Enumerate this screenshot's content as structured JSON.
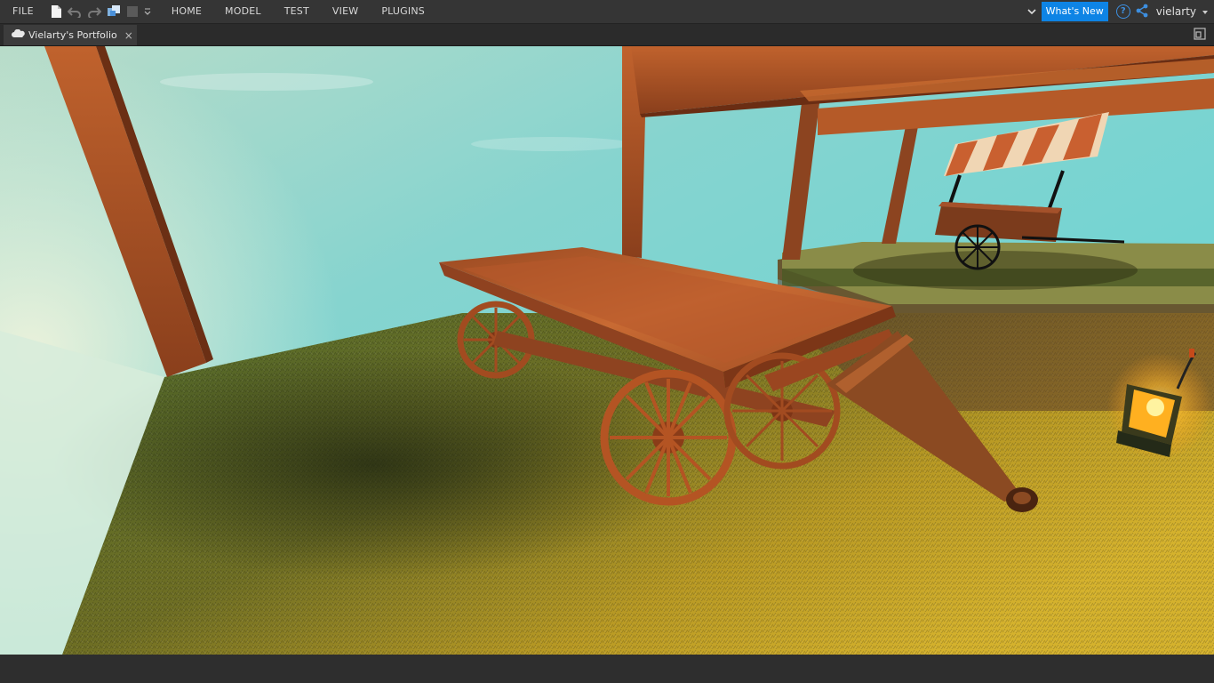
{
  "menu": {
    "file": "FILE",
    "tabs": [
      "HOME",
      "MODEL",
      "TEST",
      "VIEW",
      "PLUGINS"
    ]
  },
  "header": {
    "whats_new": "What's New",
    "help": "?",
    "username": "vielarty"
  },
  "document_tab": {
    "title": "Vielarty's Portfolio",
    "close": "×"
  },
  "colors": {
    "accent": "#0e84e5",
    "menubar": "#353535",
    "tab_active": "#3c3c3c"
  },
  "icons": [
    "new-file-icon",
    "undo-icon",
    "redo-icon",
    "package-icon",
    "stop-icon",
    "dropdown-icon",
    "chevron-down-icon",
    "share-icon",
    "cloud-icon",
    "close-icon",
    "dock-icon"
  ]
}
